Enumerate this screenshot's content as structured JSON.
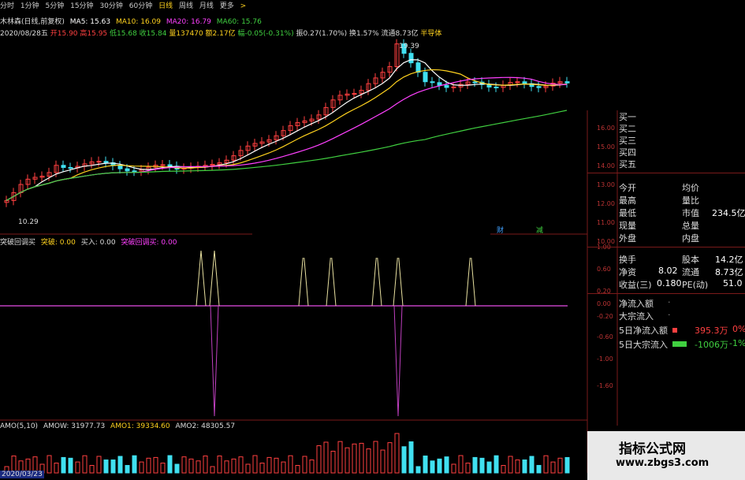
{
  "tabs": [
    {
      "label": "分时",
      "active": false
    },
    {
      "label": "1分钟",
      "active": false
    },
    {
      "label": "5分钟",
      "active": false
    },
    {
      "label": "15分钟",
      "active": false
    },
    {
      "label": "30分钟",
      "active": false
    },
    {
      "label": "60分钟",
      "active": false
    },
    {
      "label": "日线",
      "active": true
    },
    {
      "label": "周线",
      "active": false
    },
    {
      "label": "月线",
      "active": false
    },
    {
      "label": "更多",
      "active": false
    },
    {
      "label": ">",
      "active": false
    }
  ],
  "info_line": {
    "stock_period": "木林森(日线,前复权)",
    "ma5": "MA5: 15.63",
    "ma10": "MA10: 16.09",
    "ma20": "MA20: 16.79",
    "ma60": "MA60: 15.76"
  },
  "quote_line": {
    "date": "2020/08/28五",
    "open": "开15.90",
    "high": "高15.95",
    "low": "低15.68",
    "close": "收15.84",
    "volume": "量137470",
    "amount": "额2.17亿",
    "change": "幅-0.05(-0.31%)",
    "swing": "振0.27(1.70%)",
    "turnover": "换1.57%",
    "float": "流通8.73亿",
    "sector": "半导体"
  },
  "main_chart": {
    "high_label": "19.39",
    "low_label": "10.29",
    "markers": {
      "cai": "财",
      "jian": "减"
    },
    "ticks": [
      "16.00",
      "15.00",
      "14.00",
      "13.00",
      "12.00",
      "11.00",
      "10.00"
    ]
  },
  "indicator": {
    "name": "突破回调买",
    "s1": "突破: 0.00",
    "s2": "买入: 0.00",
    "s3": "突破回调买: 0.00",
    "ticks": [
      "1.00",
      "0.60",
      "0.20",
      "0.00",
      "-0.20",
      "-0.60",
      "-1.00",
      "-1.60"
    ]
  },
  "volume_panel": {
    "amo": "AMO(5,10)",
    "amow": "AMOW: 31977.73",
    "amo1": "AMO1: 39334.60",
    "amo2": "AMO2: 48305.57",
    "date": "2020/03/23"
  },
  "right_panel": {
    "bids": [
      "买一",
      "买二",
      "买三",
      "买四",
      "买五"
    ],
    "stats": [
      {
        "k1": "今开",
        "v1": "",
        "k2": "均价",
        "v2": ""
      },
      {
        "k1": "最高",
        "v1": "",
        "k2": "量比",
        "v2": ""
      },
      {
        "k1": "最低",
        "v1": "",
        "k2": "市值",
        "v2": "234.5亿"
      },
      {
        "k1": "现量",
        "v1": "",
        "k2": "总量",
        "v2": ""
      },
      {
        "k1": "外盘",
        "v1": "",
        "k2": "内盘",
        "v2": ""
      },
      {
        "k1": "换手",
        "v1": "",
        "k2": "股本",
        "v2": "14.2亿"
      },
      {
        "k1": "净资",
        "v1": "8.02",
        "k2": "流通",
        "v2": "8.73亿"
      },
      {
        "k1": "收益(三)",
        "v1": "0.180",
        "k2": "PE(动)",
        "v2": "51.0"
      }
    ],
    "flows": [
      {
        "label": "净流入额",
        "value": "",
        "pct": ""
      },
      {
        "label": "大宗流入",
        "value": "",
        "pct": ""
      },
      {
        "label": "5日净流入额",
        "value": "395.3万",
        "pct": "0%"
      },
      {
        "label": "5日大宗流入",
        "value": "-1006万",
        "pct": "-1%"
      }
    ]
  },
  "watermark": {
    "cn": "指标公式网",
    "url": "www.zbgs3.com"
  },
  "colors": {
    "up": "#ff4040",
    "down": "#40e0f0",
    "ma5": "#ffffff",
    "ma10": "#ffd21e",
    "ma20": "#ff40ff",
    "ma60": "#40d040",
    "bg": "#000000"
  }
}
